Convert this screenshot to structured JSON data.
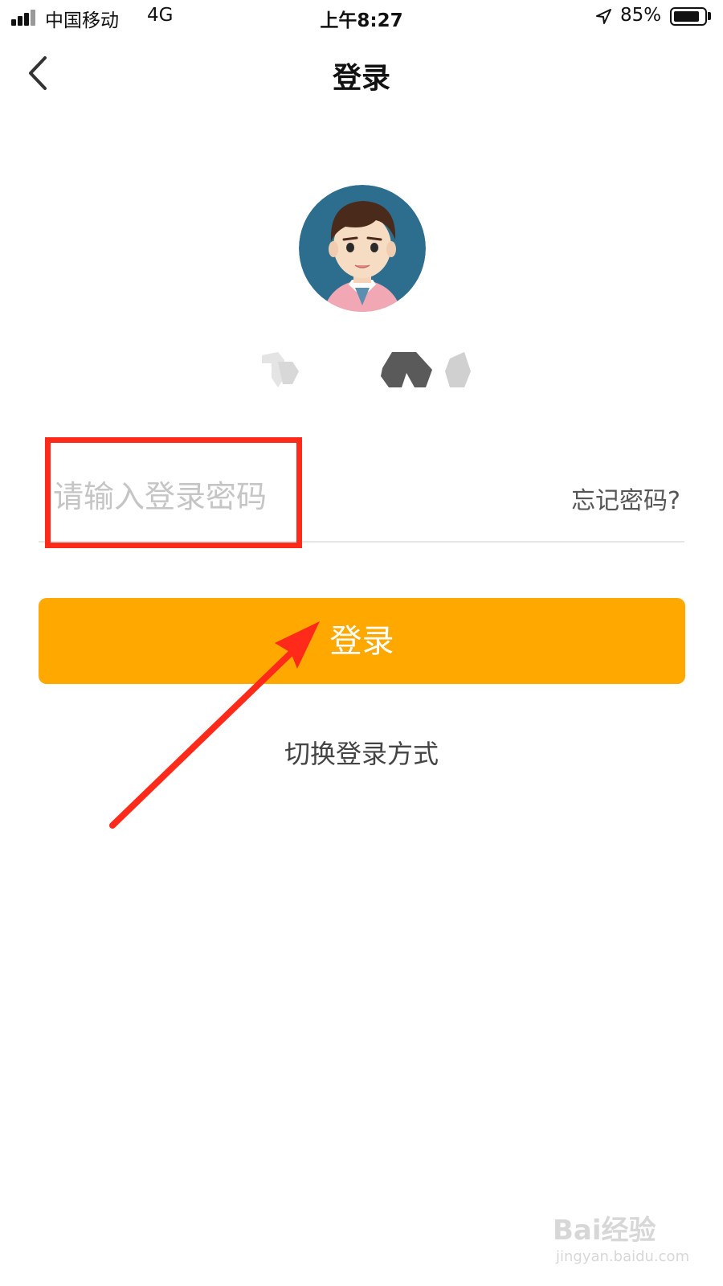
{
  "status_bar": {
    "carrier": "中国移动",
    "network": "4G",
    "time": "上午8:27",
    "battery_percent": "85%",
    "battery_level": 0.85,
    "icons": [
      "signal-icon",
      "location-icon",
      "battery-icon"
    ]
  },
  "nav": {
    "title": "登录",
    "back_icon": "chevron-left-icon"
  },
  "form": {
    "password_placeholder": "请输入登录密码",
    "password_value": "",
    "forgot_label": "忘记密码?",
    "login_label": "登录",
    "switch_label": "切换登录方式"
  },
  "colors": {
    "accent": "#ffa800",
    "annotation": "#ff2a1a"
  },
  "watermark": {
    "brand": "Bai经验",
    "url": "jingyan.baidu.com"
  }
}
